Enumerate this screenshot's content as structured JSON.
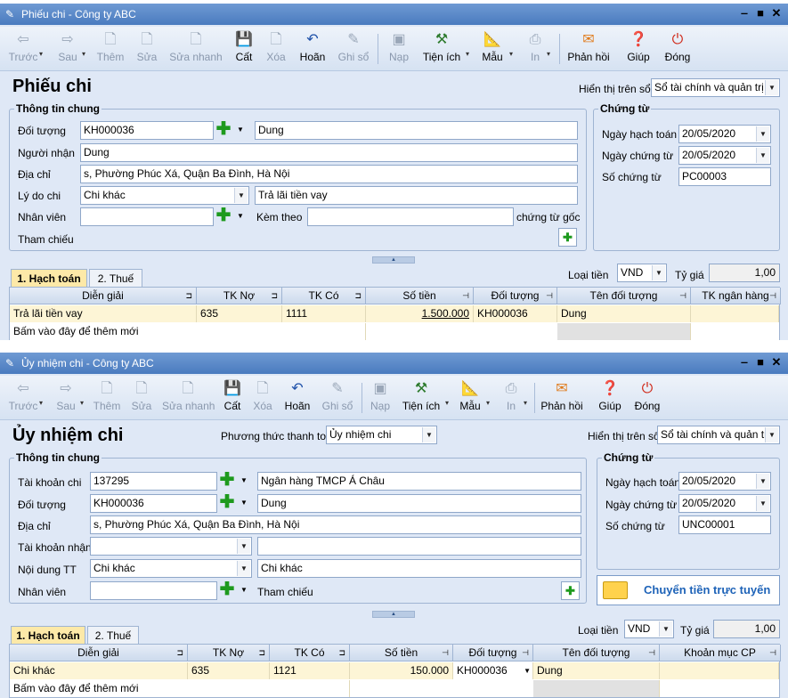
{
  "win1": {
    "title": "Phiếu chi - Công ty ABC",
    "toolbar": [
      "Trước",
      "Sau",
      "Thêm",
      "Sửa",
      "Sửa nhanh",
      "Cất",
      "Xóa",
      "Hoãn",
      "Ghi sổ",
      "Nạp",
      "Tiện ích",
      "Mẫu",
      "In",
      "Phản hồi",
      "Giúp",
      "Đóng"
    ],
    "page_title": "Phiếu chi",
    "display_label": "Hiển thị trên sổ",
    "display_value": "Sổ tài chính và quản trị",
    "general_title": "Thông tin chung",
    "doi_tuong_label": "Đối tượng",
    "doi_tuong_code": "KH000036",
    "doi_tuong_name": "Dung",
    "nguoi_nhan_label": "Người nhận",
    "nguoi_nhan": "Dung",
    "dia_chi_label": "Địa chỉ",
    "dia_chi": "s, Phường Phúc Xá, Quận Ba Đình, Hà Nội",
    "ly_do_label": "Lý do chi",
    "ly_do": "Chi khác",
    "ly_do_text": "Trả lãi tiền vay",
    "nhan_vien_label": "Nhân viên",
    "kem_theo_label": "Kèm theo",
    "chung_tu_goc": "chứng từ gốc",
    "tham_chieu": "Tham chiếu",
    "doc_title": "Chứng từ",
    "ngay_hach_toan_label": "Ngày hạch toán",
    "ngay_hach_toan": "20/05/2020",
    "ngay_chung_tu_label": "Ngày chứng từ",
    "ngay_chung_tu": "20/05/2020",
    "so_chung_tu_label": "Số chứng từ",
    "so_chung_tu": "PC00003",
    "tab1": "1. Hạch toán",
    "tab2": "2. Thuế",
    "loai_tien_label": "Loại tiền",
    "loai_tien": "VND",
    "ty_gia_label": "Tỷ giá",
    "ty_gia": "1,00",
    "cols": [
      "Diễn giải",
      "TK Nợ",
      "TK Có",
      "Số tiền",
      "Đối tượng",
      "Tên đối tượng",
      "TK ngân hàng"
    ],
    "row": [
      "Trả lãi tiền vay",
      "635",
      "1111",
      "1.500.000",
      "KH000036",
      "Dung",
      ""
    ],
    "add_row": "Bấm vào đây để thêm mới"
  },
  "win2": {
    "title": "Ủy nhiệm chi - Công ty ABC",
    "toolbar": [
      "Trước",
      "Sau",
      "Thêm",
      "Sửa",
      "Sửa nhanh",
      "Cất",
      "Xóa",
      "Hoãn",
      "Ghi sổ",
      "Nạp",
      "Tiện ích",
      "Mẫu",
      "In",
      "Phản hồi",
      "Giúp",
      "Đóng"
    ],
    "page_title": "Ủy nhiệm chi",
    "method_label": "Phương thức thanh toán",
    "method_value": "Ủy nhiệm chi",
    "display_label": "Hiển thị trên sổ",
    "display_value": "Sổ tài chính và quản trị",
    "general_title": "Thông tin chung",
    "tk_chi_label": "Tài khoản chi",
    "tk_chi": "137295",
    "tk_chi_name": "Ngân hàng TMCP Á Châu",
    "doi_tuong_label": "Đối tượng",
    "doi_tuong_code": "KH000036",
    "doi_tuong_name": "Dung",
    "dia_chi_label": "Địa chỉ",
    "dia_chi": "s, Phường Phúc Xá, Quận Ba Đình, Hà Nội",
    "tk_nhan_label": "Tài khoản nhận",
    "noi_dung_label": "Nội dung TT",
    "noi_dung": "Chi khác",
    "noi_dung_text": "Chi khác",
    "nhan_vien_label": "Nhân viên",
    "tham_chieu": "Tham chiếu",
    "doc_title": "Chứng từ",
    "ngay_hach_toan_label": "Ngày hạch toán",
    "ngay_hach_toan": "20/05/2020",
    "ngay_chung_tu_label": "Ngày chứng từ",
    "ngay_chung_tu": "20/05/2020",
    "so_chung_tu_label": "Số chứng từ",
    "so_chung_tu": "UNC00001",
    "transfer_btn": "Chuyển tiền trực tuyến",
    "tab1": "1. Hạch toán",
    "tab2": "2. Thuế",
    "loai_tien_label": "Loại tiền",
    "loai_tien": "VND",
    "ty_gia_label": "Tỷ giá",
    "ty_gia": "1,00",
    "cols": [
      "Diễn giải",
      "TK Nợ",
      "TK Có",
      "Số tiền",
      "Đối tượng",
      "Tên đối tượng",
      "Khoản mục CP"
    ],
    "row": [
      "Chi khác",
      "635",
      "1121",
      "150.000",
      "KH000036",
      "Dung",
      ""
    ],
    "add_row": "Bấm vào đây để thêm mới"
  }
}
